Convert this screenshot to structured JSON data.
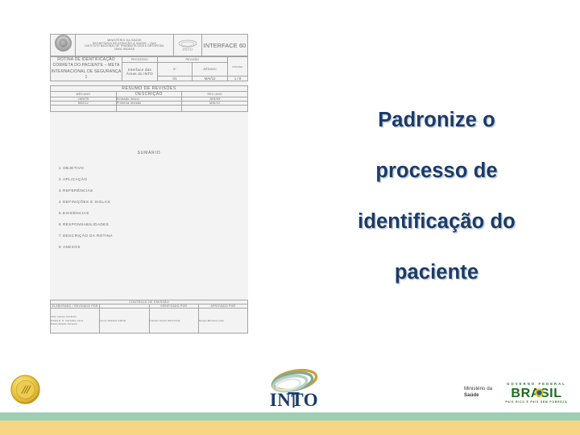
{
  "slide": {
    "title_lines": [
      "Padronize o",
      "processo de",
      "identificação do",
      "paciente"
    ],
    "title_color": "#1b3b68",
    "background_color": "#ffffff"
  },
  "document": {
    "header": {
      "brasao_icon": "brasao-republica-icon",
      "org_line1": "MINISTÉRIO DA SAÚDE",
      "org_line2": "SECRETARIA DE ATENÇÃO À SAÚDE – SAS",
      "org_line3": "INSTITUTO NACIONAL DE TRAUMATOLOGIA E ORTOPEDIA",
      "org_line4": "JAMIL HADDAD",
      "into_logo_icon": "into-logo-icon",
      "interface_label": "INTERFACE 60",
      "rotina_title": "ROTINA DE IDENTIFICAÇÃO CORRETA DO PACIENTE – META INTERNACIONAL DE SEGURANÇA 1",
      "processo_label": "PROCESSO",
      "processo_name": "Interface das Áreas do INTO",
      "revisao_label": "REVISÃO",
      "revisao_num_label": "Nº",
      "revisao_mes_label": "MÊS/ANO",
      "revisao_num": "01",
      "revisao_mes": "MAI/12",
      "pagina_label": "PÁGINA",
      "pagina_val": "1 / 8"
    },
    "revisions": {
      "title": "RESUMO DE REVISÕES",
      "col_mes_ano": "MÊS/ANO",
      "col_descricao": "DESCRIÇÃO",
      "col_rev_ano": "REV./ANO",
      "rows": [
        {
          "mes_ano": "JAN/09",
          "descricao": "Emissão inicial",
          "rev_ano": "JAN/09"
        },
        {
          "mes_ano": "MAI/12",
          "descricao": "Primeira revisão",
          "rev_ano": "MAI/12"
        },
        {
          "mes_ano": "",
          "descricao": "",
          "rev_ano": ""
        }
      ]
    },
    "sumario": {
      "title": "SUMÁRIO",
      "items": [
        {
          "num": "1",
          "label": "OBJETIVO"
        },
        {
          "num": "2",
          "label": "APLICAÇÃO"
        },
        {
          "num": "3",
          "label": "REFERÊNCIAS"
        },
        {
          "num": "4",
          "label": "DEFINIÇÕES E SIGLAS"
        },
        {
          "num": "5",
          "label": "EXIGÊNCIAS"
        },
        {
          "num": "6",
          "label": "RESPONSABILIDADES"
        },
        {
          "num": "7",
          "label": "DESCRIÇÃO DA ROTINA"
        },
        {
          "num": "8",
          "label": "ANEXOS"
        }
      ]
    },
    "signatures": {
      "title": "CONTROLE DE EMISSÃO",
      "col1_head": "ELABORADO / REVISADO   POR",
      "col2_head": "VERIFICADO   POR",
      "col3_head": "APROVADO   POR",
      "col1_body": "Jose Carlos Cordeiro\nFlavia P. S. Carvalho Lima\nPaulo Duarte Teixeira",
      "col2_body": "Ivone Oliveira Cabral",
      "col3_body": "Clemax Couto Sant'Anna",
      "col4_body": "Sergio Mendes Leite"
    }
  },
  "logos": {
    "gold_seal_icon": "gold-seal-icon",
    "into_logo_icon": "into-logo-icon",
    "ministerio_line1": "Ministério da",
    "ministerio_line2": "Saúde",
    "governo_federal": "GOVERNO FEDERAL",
    "brasil_wordmark": "BRASIL",
    "brasil_tagline": "PAÍS RICO É PAÍS SEM POBREZA"
  },
  "footer": {
    "bar_green_color": "#9ccfb4",
    "bar_yellow_color": "#f7d683"
  }
}
